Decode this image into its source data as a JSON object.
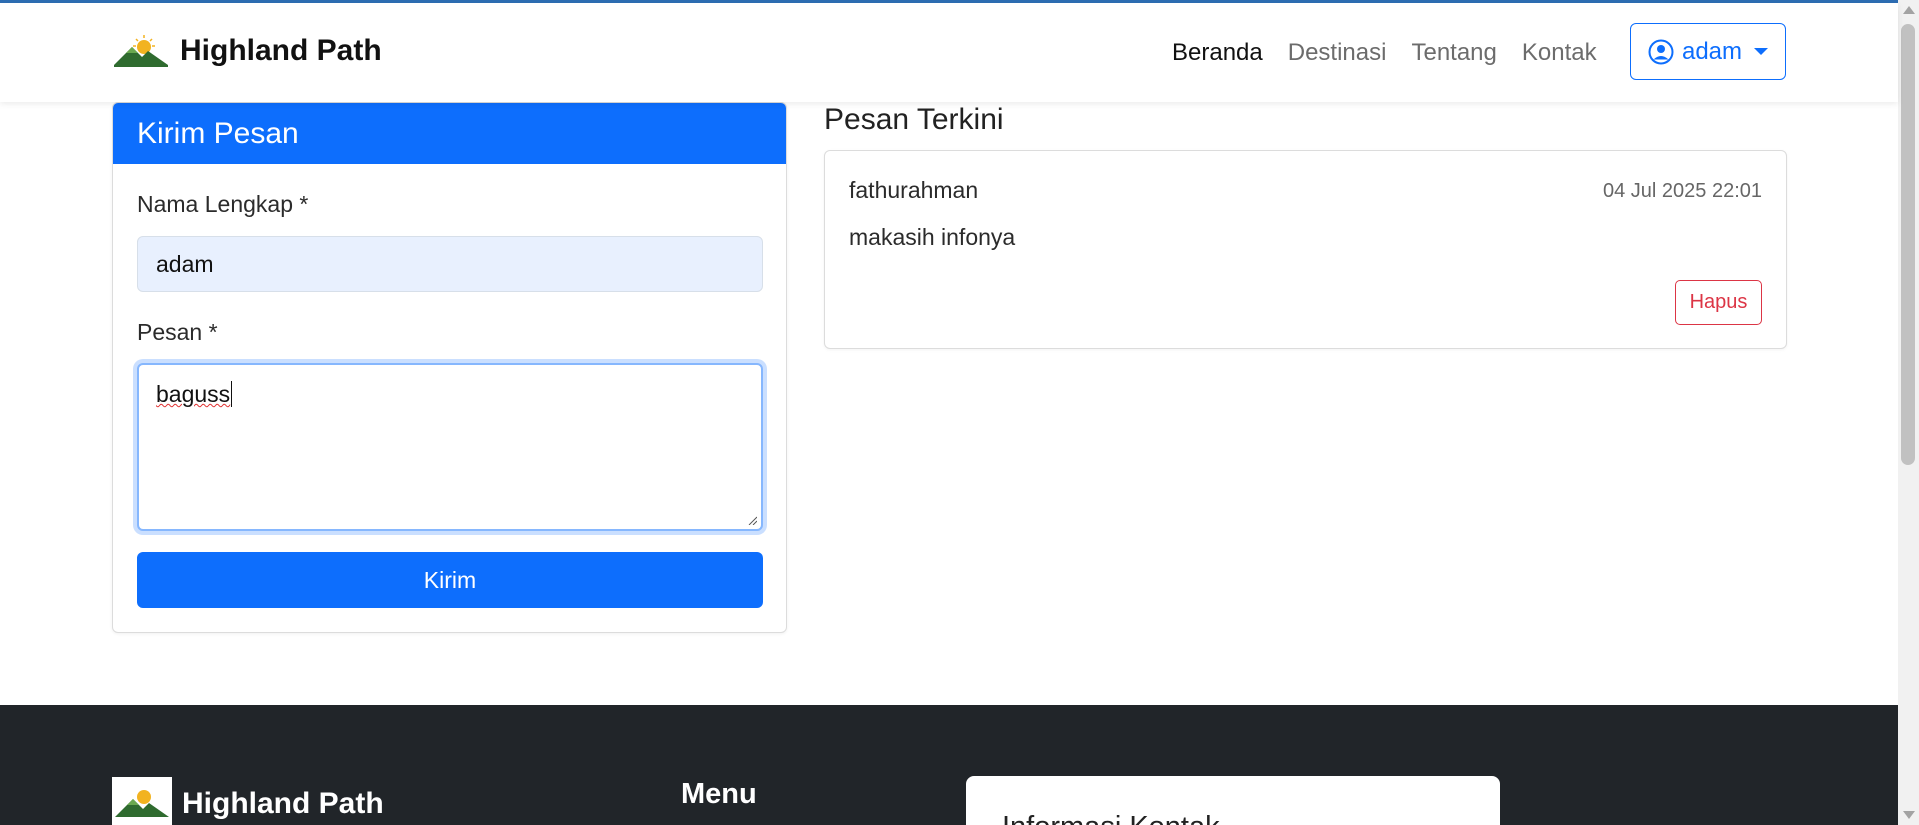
{
  "navbar": {
    "brand_name": "Highland Path",
    "logo_icon": "mountain-sun-logo",
    "links": [
      "Beranda",
      "Destinasi",
      "Tentang",
      "Kontak"
    ],
    "active_link": "Beranda",
    "user": {
      "name": "adam",
      "icon": "user-circle-icon"
    }
  },
  "form": {
    "title": "Kirim Pesan",
    "name_label": "Nama Lengkap *",
    "name_value": "adam",
    "message_label": "Pesan *",
    "message_value": "baguss",
    "submit_label": "Kirim"
  },
  "recent": {
    "title": "Pesan Terkini",
    "messages": [
      {
        "author": "fathurahman",
        "time": "04 Jul 2025 22:01",
        "body": "makasih infonya",
        "delete_label": "Hapus"
      }
    ]
  },
  "footer": {
    "brand_name": "Highland Path",
    "menu_title": "Menu",
    "contact_card_title": "Informasi Kontak"
  },
  "colors": {
    "primary": "#0d6efd",
    "danger": "#dc3545",
    "footer_bg": "#212529"
  }
}
